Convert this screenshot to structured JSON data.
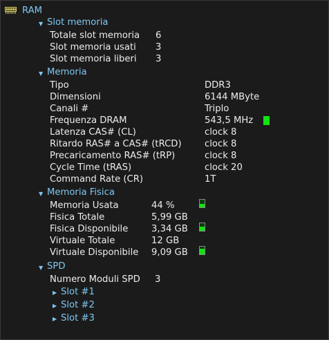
{
  "ram": {
    "title": "RAM",
    "slot_memoria": {
      "title": "Slot memoria",
      "rows": [
        {
          "label": "Totale slot memoria",
          "value": "6"
        },
        {
          "label": "Slot memoria usati",
          "value": "3"
        },
        {
          "label": "Slot memoria liberi",
          "value": "3"
        }
      ]
    },
    "memoria": {
      "title": "Memoria",
      "rows": [
        {
          "label": "Tipo",
          "value": "DDR3"
        },
        {
          "label": "Dimensioni",
          "value": "6144 MByte"
        },
        {
          "label": "Canali #",
          "value": "Triplo"
        },
        {
          "label": "Frequenza DRAM",
          "value": "543,5 MHz"
        },
        {
          "label": "Latenza CAS# (CL)",
          "value": "clock 8"
        },
        {
          "label": "Ritardo RAS# a CAS# (tRCD)",
          "value": "clock 8"
        },
        {
          "label": "Precaricamento RAS# (tRP)",
          "value": "clock 8"
        },
        {
          "label": "Cycle Time (tRAS)",
          "value": "clock 20"
        },
        {
          "label": "Command Rate (CR)",
          "value": "1T"
        }
      ]
    },
    "memoria_fisica": {
      "title": "Memoria Fisica",
      "rows": [
        {
          "label": "Memoria Usata",
          "value": "44 %",
          "gauge": 0.44
        },
        {
          "label": "Fisica Totale",
          "value": "5,99 GB"
        },
        {
          "label": "Fisica Disponibile",
          "value": "3,34 GB",
          "gauge": 0.56
        },
        {
          "label": "Virtuale Totale",
          "value": "12 GB"
        },
        {
          "label": "Virtuale Disponibile",
          "value": "9,09 GB",
          "gauge": 0.76
        }
      ]
    },
    "spd": {
      "title": "SPD",
      "modules_label": "Numero Moduli SPD",
      "modules_value": "3",
      "slots": [
        "Slot #1",
        "Slot #2",
        "Slot #3"
      ]
    }
  },
  "colors": {
    "background": "#1b1b1b",
    "header_text": "#7fc8f2",
    "value_text": "#ececec",
    "gauge_green": "#13e213"
  },
  "icons": {
    "ram": "ram-chip-icon",
    "expanded": "triangle-down-icon",
    "collapsed": "triangle-right-icon",
    "gauge": "bar-gauge-icon"
  }
}
